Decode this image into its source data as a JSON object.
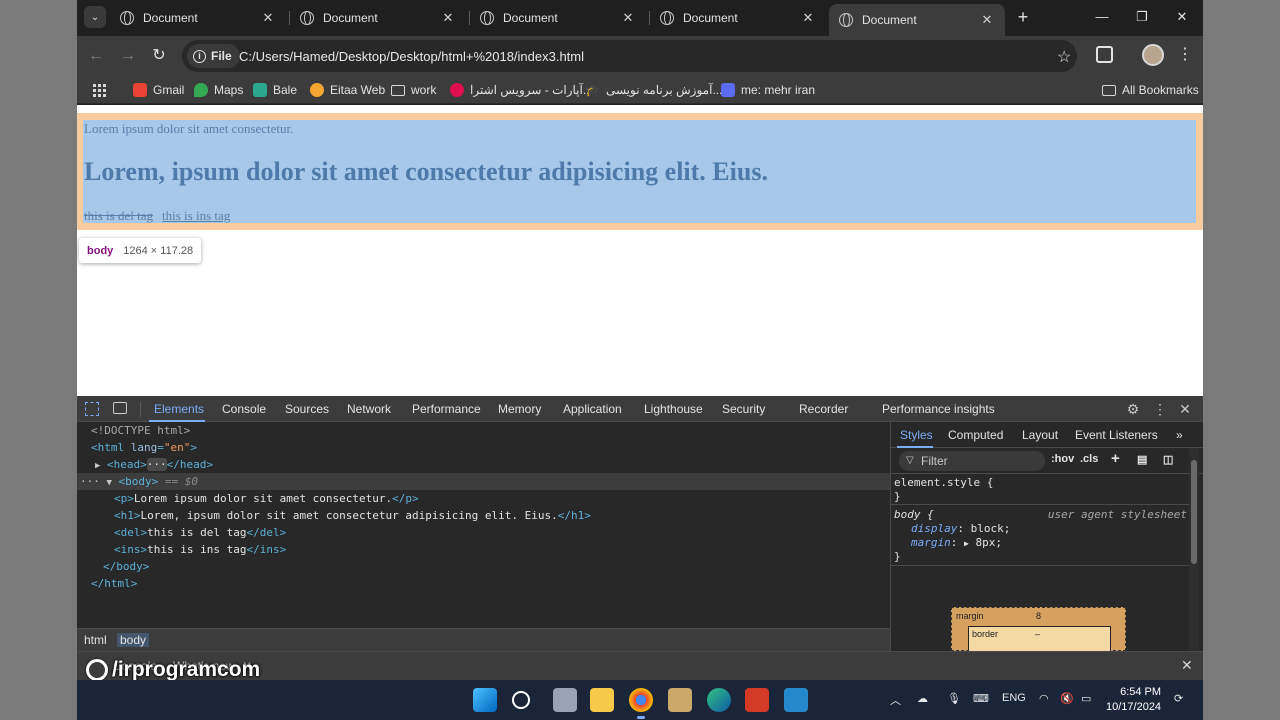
{
  "browser": {
    "tabs": [
      {
        "title": "Document",
        "active": false
      },
      {
        "title": "Document",
        "active": false
      },
      {
        "title": "Document",
        "active": false
      },
      {
        "title": "Document",
        "active": false
      },
      {
        "title": "Document",
        "active": true
      }
    ],
    "address": {
      "scheme_chip": "File",
      "url": "C:/Users/Hamed/Desktop/Desktop/html+%2018/index3.html"
    },
    "bookmarks": [
      {
        "label": "Gmail",
        "icon": "gmail-icon",
        "color": "#ea4335"
      },
      {
        "label": "Maps",
        "icon": "maps-pin-icon",
        "color": "#34a853"
      },
      {
        "label": "Bale",
        "icon": "bale-icon",
        "color": "#2ba88c"
      },
      {
        "label": "Eitaa Web",
        "icon": "eitaa-icon",
        "color": "#f7a531"
      },
      {
        "label": "work",
        "icon": "folder-icon",
        "color": ""
      },
      {
        "label": "آپارات - سرویس اشترا...",
        "icon": "aparat-icon",
        "color": "#df0f50"
      },
      {
        "label": "آموزش برنامه نویسی...",
        "icon": "grad-cap-icon",
        "color": "#ffffff"
      },
      {
        "label": "me: mehr iran",
        "icon": "mehr-icon",
        "color": "#5b6cf0"
      }
    ],
    "all_bookmarks": "All Bookmarks"
  },
  "page": {
    "p_text": "Lorem ipsum dolor sit amet consectetur.",
    "h1_text": "Lorem, ipsum dolor sit amet consectetur adipisicing elit. Eius.",
    "del_text": "this is del tag",
    "ins_text": "this is ins tag",
    "tooltip_tag": "body",
    "tooltip_dims": "1264 × 117.28"
  },
  "devtools": {
    "tabs": [
      "Elements",
      "Console",
      "Sources",
      "Network",
      "Performance",
      "Memory",
      "Application",
      "Lighthouse",
      "Security",
      "Recorder",
      "Performance insights"
    ],
    "active_tab": "Elements",
    "dom": {
      "doctype": "<!DOCTYPE html>",
      "html_open": "<html",
      "html_attr_name": "lang",
      "html_attr_value": "\"en\"",
      "html_close_bracket": ">",
      "head": "<head>",
      "head_dots": "···",
      "head_close": "</head>",
      "body_dots": "···",
      "body_open": "<body>",
      "body_eq": "==",
      "body_dollar": "$0",
      "p_open": "<p>",
      "p_text": "Lorem ipsum dolor sit amet consectetur.",
      "p_close": "</p>",
      "h1_open": "<h1>",
      "h1_text": "Lorem, ipsum dolor sit amet consectetur adipisicing elit. Eius.",
      "h1_close": "</h1>",
      "del_open": "<del>",
      "del_text": "this is del tag",
      "del_close": "</del>",
      "ins_open": "<ins>",
      "ins_text": "this is ins tag",
      "ins_close": "</ins>",
      "body_close": "</body>",
      "html_close": "</html>"
    },
    "breadcrumbs": [
      "html",
      "body"
    ],
    "styles": {
      "tabs": [
        "Styles",
        "Computed",
        "Layout",
        "Event Listeners"
      ],
      "filter_placeholder": "Filter",
      "hov": ":hov",
      "cls": ".cls",
      "element_style": "element.style {",
      "close_brace": "}",
      "body_selector": "body {",
      "ua_label": "user agent stylesheet",
      "decl1_prop": "display",
      "decl1_value": "block;",
      "decl2_prop": "margin",
      "decl2_value": "8px;",
      "box_margin_label": "margin",
      "box_margin_value": "8",
      "box_border_label": "border",
      "box_border_value": "–"
    },
    "drawer_tabs": [
      "Console",
      "What's new"
    ]
  },
  "watermark": "/irprogramcom",
  "taskbar": {
    "lang": "ENG",
    "time": "6:54 PM",
    "date": "10/17/2024"
  }
}
